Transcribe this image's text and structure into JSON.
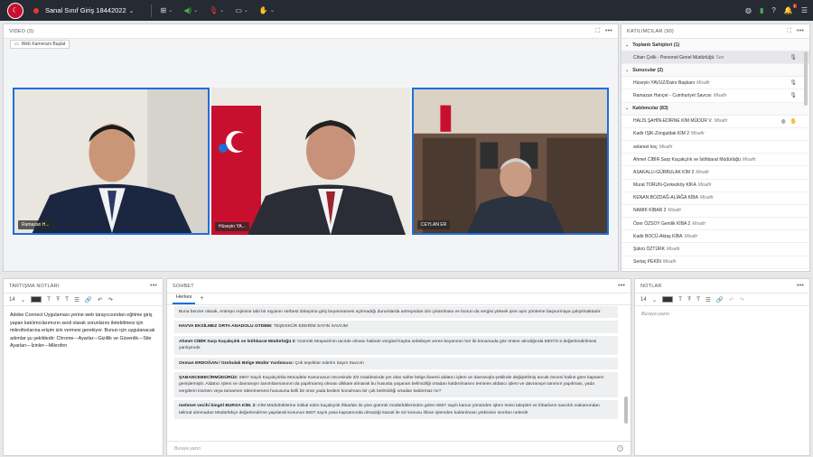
{
  "topbar": {
    "title": "Sanal Sınıf Giriş 18442022",
    "colors": {
      "bg": "#262a33",
      "rec": "#e53935"
    },
    "icons": [
      "grid-icon",
      "speaker-icon",
      "mic-icon",
      "camera-icon",
      "hand-icon"
    ],
    "right_icons": [
      "wifi-icon",
      "bars-icon",
      "help-icon",
      "bell-icon",
      "menu-icon"
    ]
  },
  "video": {
    "header": "VIDEO (3)",
    "webcam_button": "Web Kameranı Başlat",
    "tiles": [
      {
        "label": "Ramazan H..."
      },
      {
        "label": "Hüseyin YA..."
      },
      {
        "label": "CEYLAN ER"
      }
    ]
  },
  "participants": {
    "header": "KATILIMCILAR (90)",
    "groups": [
      {
        "title": "Toplantı Sahipleri (1)",
        "rows": [
          {
            "name": "Cihan Çelik - Personel Genel Müdürlüğü",
            "role": "Sen"
          }
        ]
      },
      {
        "title": "Sunucular (2)",
        "rows": [
          {
            "name": "Hüseyin YAVUZ/Daire Başkanı",
            "role": "Misafir"
          },
          {
            "name": "Ramazan Hançer - Cumhuriyet Savcısı",
            "role": "Misafir"
          }
        ]
      },
      {
        "title": "Katılımcılar (83)",
        "rows": [
          {
            "name": "HALİS ŞAHİN-EDİRNE KİM MÜDÜR V.",
            "role": "Misafir"
          },
          {
            "name": "Kadir IŞIK-Zonguldak KİM 2",
            "role": "Misafir"
          },
          {
            "name": "selamet koç",
            "role": "Misafir"
          },
          {
            "name": "Ahmet CİBİR Sarp Kaçakçılık ve İstihbarat Müdürlüğü",
            "role": "Misafir"
          },
          {
            "name": "ASAKALLI-GÜRBULAK KİM 2",
            "role": "Misafir"
          },
          {
            "name": "Murat TORUN-Çerkezköy KİKA",
            "role": "Misafir"
          },
          {
            "name": "KENAN BOZDAĞ-ALİAĞA KİBA",
            "role": "Misafir"
          },
          {
            "name": "NAMIK KİBAR 2",
            "role": "Misafir"
          },
          {
            "name": "Özer ÖZSOY Gemlik KİBA 2",
            "role": "Misafir"
          },
          {
            "name": "Kadir BOCÜ-Aktaş KİBA",
            "role": "Misafir"
          },
          {
            "name": "Şükrü ÖZTÜRK",
            "role": "Misafir"
          },
          {
            "name": "Sertaç PEKİN",
            "role": "Misafir"
          }
        ]
      }
    ]
  },
  "discussion": {
    "header": "TARTIŞMA NOTLARI",
    "font_size": "14",
    "text": "Adobe Connect Uygulaması yerine web tarayıcısından eğitime giriş yapan katılımcılarımızın sesli olarak sorunlarını iletebilmesi için mikrofonlarına erişim izin vermesi gerekiyor. Bunun için uygulanacak adımlar şu şekildedir: Chrome---Ayarlar---Gizlilik ve Güvenlik---Site Ayarları---İzinler---Mikrofon"
  },
  "chat": {
    "header": "SOHBET",
    "tab": "Herkes",
    "input_placeholder": "Buraya yazın",
    "messages": [
      {
        "sender": "",
        "text": "Buna benzer olarak, Antrepo rejimine tabi bir eşyanın serbest dolaşıma giriş beyannamesi açılmadığı durumlarda antrepodan izin çıkarılması ve bunun da vergisi yüksek şine aynı yönteme başvurmaya çalışılmaktadır."
      },
      {
        "sender": "HAVVA EKSİLMEZ ORTA ANADOLU GTDBM:",
        "text": "TEŞEKKÜR EDERİM SAYIN SAVCIM"
      },
      {
        "sender": "Ahmet CİBİR Sarp Kaçakçılık ve İstihbarat Müdürlüğü 2:",
        "text": "Gümrük Müşavirinin tacirde olması halinde vergisel kayba sebebiyet veren beyanının her iki konumuda göz önüne alındığında 5607/3-2 değerlendirilmesi yanlışmıdır"
      },
      {
        "sender": "Osman ERDOĞAN / Gürbulak Bölge Müdür Yardımcısı:",
        "text": "Çok teşekkür ederim Sayın Savcım"
      },
      {
        "sender": "ŞABANCEBECİRMÜDÜRÜ2:",
        "text": "5607 Sayılı Kaçakçılıkla Mücadele Kanununun öncesinde 3/2 maddesinde yer alan sahte belge ibaresi aldatıcı işlem ve davranışla şeklinde değiştirilmiş ancak öncesi haline göre kapsamı genişlemiştir. Aldatıcı işlem ve davranışın tanımlanmasının da yapılmamış olması dikkate alınarak bu hususta yaşanan belirsizliği ortadan kaldırılmasını teminen aldatıcı işlem ve davranışın tanımın yapılması, yada vergilerin kısmen veya tamamen ödenmemesi hususuna belli bir oran yada bedeni konulması bir çok belirsizliği ortadan kaldırmaz mı?"
      },
      {
        "sender": "mehmet vecihi bingöl BURSA KİM. 2:",
        "text": "KİM Müdürlüklerine intikal eden kaçakçılık ihbarları ile yine gümrük müdürlüklerinden gelen 5607 sayılı kanun yönünden işlem tesisi talepleri ve ihbarların savcılık makamından talimat alınmadan Müdürlükçe değerlendirme yapılarak konunun 5607 sayılı yasa kapsamında olmadığı kanati ile siz konusu ihban işlemden kaldırılması yetkisinin sınırları nelerdir"
      }
    ]
  },
  "notes": {
    "header": "NOTLAR",
    "font_size": "14",
    "placeholder": "Buraya yazın"
  }
}
